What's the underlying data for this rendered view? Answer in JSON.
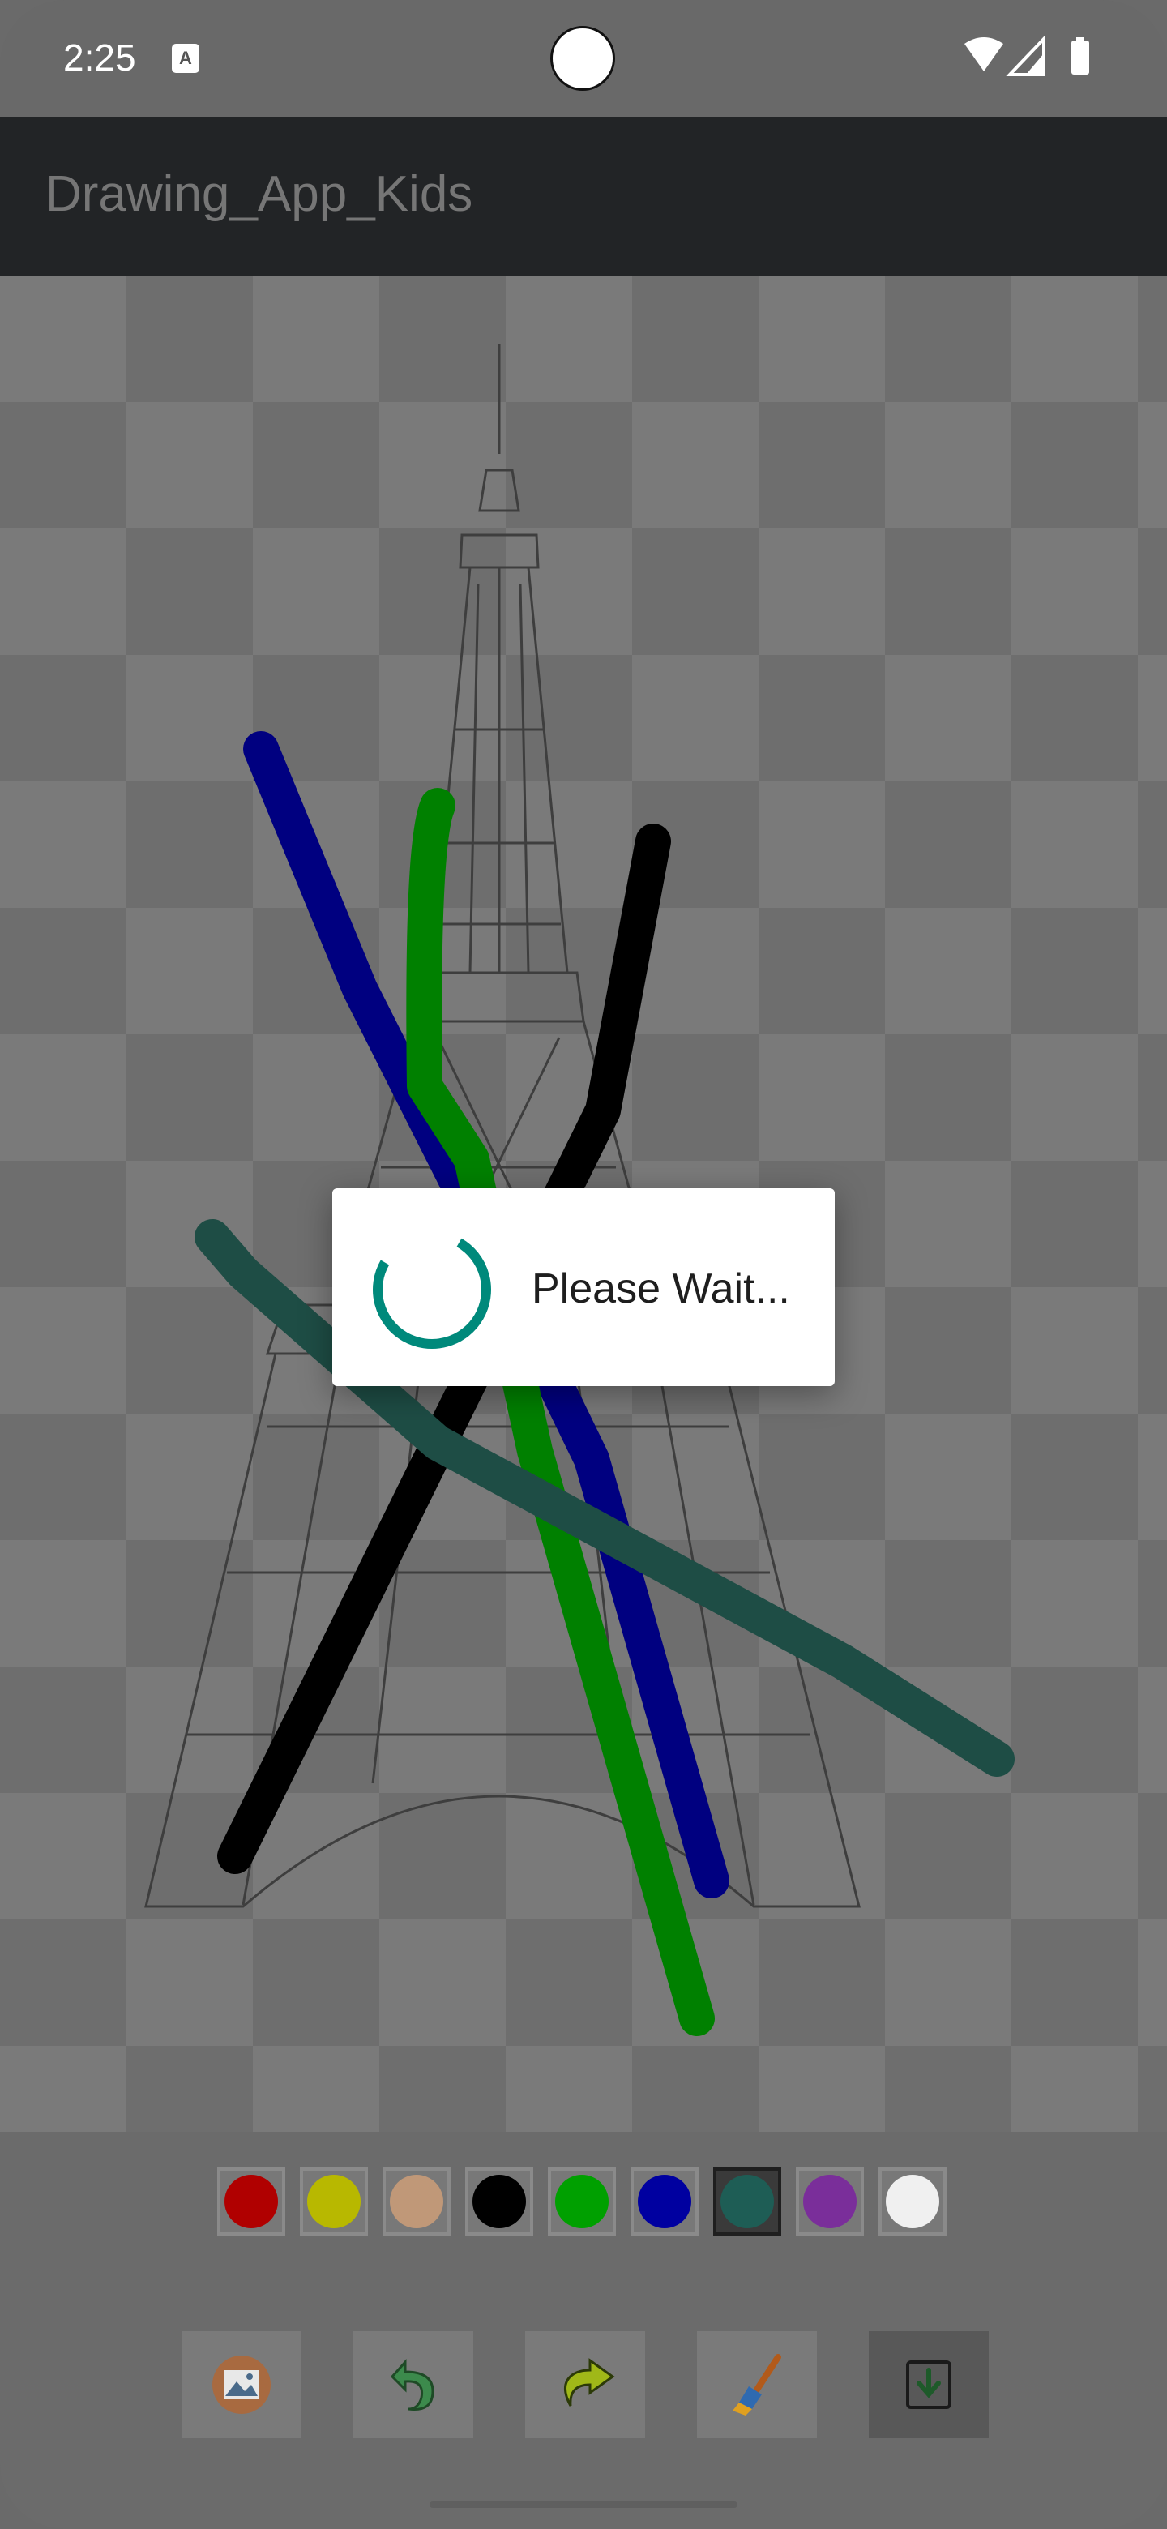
{
  "status_bar": {
    "time": "2:25",
    "notification_icon": "A",
    "icons": [
      "wifi-icon",
      "signal-icon",
      "battery-icon"
    ]
  },
  "app_bar": {
    "title": "Drawing_App_Kids"
  },
  "canvas": {
    "background_image": "eiffel-tower-outline",
    "stroke_colors": [
      "#000080",
      "#008000",
      "#000000",
      "#1e4d45"
    ]
  },
  "palette": {
    "colors": [
      "#b00000",
      "#b8b800",
      "#c09878",
      "#000000",
      "#00a000",
      "#0000a0",
      "#1e5d55",
      "#7a2e9a",
      "#f0f0f0"
    ],
    "selected_index": 6
  },
  "toolbar": {
    "tools": [
      {
        "name": "gallery-button",
        "icon": "gallery-icon"
      },
      {
        "name": "undo-button",
        "icon": "undo-icon"
      },
      {
        "name": "redo-button",
        "icon": "redo-icon"
      },
      {
        "name": "brush-size-button",
        "icon": "brush-icon"
      },
      {
        "name": "save-button",
        "icon": "save-icon"
      }
    ],
    "selected_tool": "save-button"
  },
  "dialog": {
    "message": "Please Wait...",
    "accent_color": "#00897b"
  }
}
